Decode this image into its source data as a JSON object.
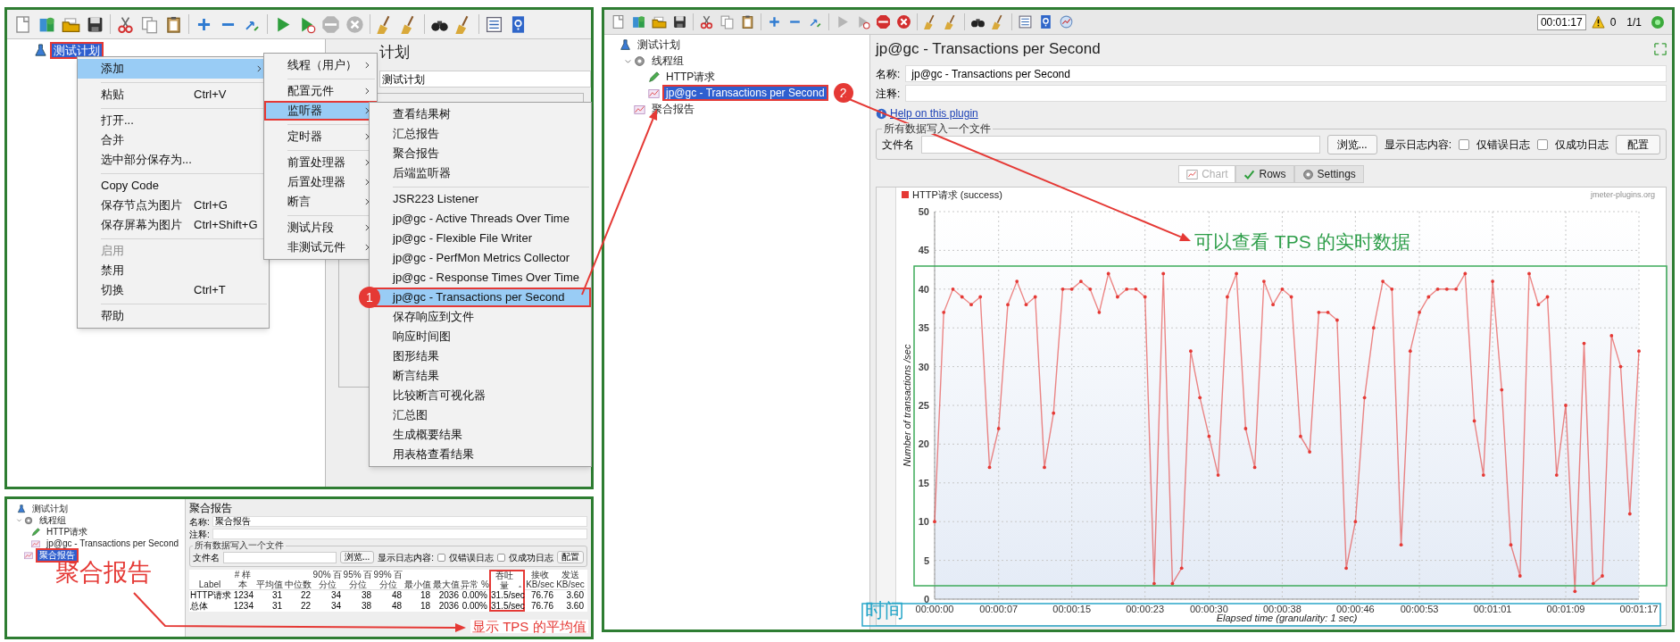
{
  "menu_screenshot": {
    "running": false,
    "tree": [
      {
        "label": "测试计划",
        "kind": "plan",
        "selected": true,
        "annotated": true
      }
    ],
    "editor": {
      "title": "计划",
      "name_value": "测试计划"
    },
    "context_menu": [
      {
        "label": "添加",
        "selected": true,
        "disabled": false,
        "submenu": true,
        "separator_before": false,
        "annotated": false
      },
      {
        "label": "粘贴",
        "shortcut": "Ctrl+V",
        "selected": false,
        "disabled": false,
        "submenu": false,
        "separator_before": true,
        "annotated": false
      },
      {
        "label": "打开...",
        "selected": false,
        "disabled": false,
        "submenu": false,
        "separator_before": true,
        "annotated": false
      },
      {
        "label": "合并",
        "selected": false,
        "disabled": false,
        "submenu": false,
        "separator_before": false,
        "annotated": false
      },
      {
        "label": "选中部分保存为...",
        "selected": false,
        "disabled": false,
        "submenu": false,
        "separator_before": false,
        "annotated": false
      },
      {
        "label": "Copy Code",
        "selected": false,
        "disabled": false,
        "submenu": false,
        "separator_before": true,
        "annotated": false
      },
      {
        "label": "保存节点为图片",
        "shortcut": "Ctrl+G",
        "selected": false,
        "disabled": false,
        "submenu": false,
        "separator_before": false,
        "annotated": false
      },
      {
        "label": "保存屏幕为图片",
        "shortcut": "Ctrl+Shift+G",
        "selected": false,
        "disabled": false,
        "submenu": false,
        "separator_before": false,
        "annotated": false
      },
      {
        "label": "启用",
        "selected": false,
        "disabled": true,
        "submenu": false,
        "separator_before": true,
        "annotated": false
      },
      {
        "label": "禁用",
        "selected": false,
        "disabled": false,
        "submenu": false,
        "separator_before": false,
        "annotated": false
      },
      {
        "label": "切换",
        "shortcut": "Ctrl+T",
        "selected": false,
        "disabled": false,
        "submenu": false,
        "separator_before": false,
        "annotated": false
      },
      {
        "label": "帮助",
        "selected": false,
        "disabled": false,
        "submenu": false,
        "separator_before": true,
        "annotated": false
      }
    ],
    "add_menu": [
      {
        "label": "线程（用户）",
        "selected": false,
        "disabled": false,
        "submenu": true,
        "separator_before": false,
        "annotated": false
      },
      {
        "label": "配置元件",
        "selected": false,
        "disabled": false,
        "submenu": true,
        "separator_before": true,
        "annotated": false
      },
      {
        "label": "监听器",
        "selected": true,
        "disabled": false,
        "submenu": true,
        "separator_before": false,
        "annotated": true
      },
      {
        "label": "定时器",
        "selected": false,
        "disabled": false,
        "submenu": true,
        "separator_before": true,
        "annotated": false
      },
      {
        "label": "前置处理器",
        "selected": false,
        "disabled": false,
        "submenu": true,
        "separator_before": true,
        "annotated": false
      },
      {
        "label": "后置处理器",
        "selected": false,
        "disabled": false,
        "submenu": true,
        "separator_before": false,
        "annotated": false
      },
      {
        "label": "断言",
        "selected": false,
        "disabled": false,
        "submenu": true,
        "separator_before": false,
        "annotated": false
      },
      {
        "label": "测试片段",
        "selected": false,
        "disabled": false,
        "submenu": true,
        "separator_before": true,
        "annotated": false
      },
      {
        "label": "非测试元件",
        "selected": false,
        "disabled": false,
        "submenu": true,
        "separator_before": false,
        "annotated": false
      }
    ],
    "listener_menu": [
      {
        "label": "查看结果树",
        "selected": false,
        "disabled": false,
        "submenu": false,
        "separator_before": false,
        "annotated": false
      },
      {
        "label": "汇总报告",
        "selected": false,
        "disabled": false,
        "submenu": false,
        "separator_before": false,
        "annotated": false
      },
      {
        "label": "聚合报告",
        "selected": false,
        "disabled": false,
        "submenu": false,
        "separator_before": false,
        "annotated": false
      },
      {
        "label": "后端监听器",
        "selected": false,
        "disabled": false,
        "submenu": false,
        "separator_before": false,
        "annotated": false
      },
      {
        "label": "JSR223 Listener",
        "selected": false,
        "disabled": false,
        "submenu": false,
        "separator_before": true,
        "annotated": false
      },
      {
        "label": "jp@gc - Active Threads Over Time",
        "selected": false,
        "disabled": false,
        "submenu": false,
        "separator_before": false,
        "annotated": false
      },
      {
        "label": "jp@gc - Flexible File Writer",
        "selected": false,
        "disabled": false,
        "submenu": false,
        "separator_before": false,
        "annotated": false
      },
      {
        "label": "jp@gc - PerfMon Metrics Collector",
        "selected": false,
        "disabled": false,
        "submenu": false,
        "separator_before": false,
        "annotated": false
      },
      {
        "label": "jp@gc - Response Times Over Time",
        "selected": false,
        "disabled": false,
        "submenu": false,
        "separator_before": false,
        "annotated": false
      },
      {
        "label": "jp@gc - Transactions per Second",
        "selected": true,
        "disabled": false,
        "submenu": false,
        "separator_before": false,
        "annotated": true,
        "badge": "1"
      },
      {
        "label": "保存响应到文件",
        "selected": false,
        "disabled": false,
        "submenu": false,
        "separator_before": false,
        "annotated": false
      },
      {
        "label": "响应时间图",
        "selected": false,
        "disabled": false,
        "submenu": false,
        "separator_before": false,
        "annotated": false
      },
      {
        "label": "图形结果",
        "selected": false,
        "disabled": false,
        "submenu": false,
        "separator_before": false,
        "annotated": false
      },
      {
        "label": "断言结果",
        "selected": false,
        "disabled": false,
        "submenu": false,
        "separator_before": false,
        "annotated": false
      },
      {
        "label": "比较断言可视化器",
        "selected": false,
        "disabled": false,
        "submenu": false,
        "separator_before": false,
        "annotated": false
      },
      {
        "label": "汇总图",
        "selected": false,
        "disabled": false,
        "submenu": false,
        "separator_before": false,
        "annotated": false
      },
      {
        "label": "生成概要结果",
        "selected": false,
        "disabled": false,
        "submenu": false,
        "separator_before": false,
        "annotated": false
      },
      {
        "label": "用表格查看结果",
        "selected": false,
        "disabled": false,
        "submenu": false,
        "separator_before": false,
        "annotated": false
      }
    ]
  },
  "summary_screenshot": {
    "tree": [
      {
        "label": "测试计划",
        "kind": "plan",
        "selected": false,
        "annotated": false,
        "children": [
          {
            "label": "线程组",
            "kind": "group",
            "selected": false,
            "annotated": false,
            "expanded": true,
            "children": [
              {
                "label": "HTTP请求",
                "kind": "sampler",
                "selected": false,
                "annotated": false
              },
              {
                "label": "jp@gc - Transactions per Second",
                "kind": "listener",
                "selected": false,
                "annotated": false
              }
            ]
          },
          {
            "label": "聚合报告",
            "kind": "listener",
            "selected": true,
            "annotated": true
          }
        ]
      }
    ],
    "editor": {
      "title": "聚合报告",
      "name_label": "名称:",
      "name_value": "聚合报告",
      "comment_label": "注释:",
      "file_group": {
        "legend": "所有数据写入一个文件",
        "file_label": "文件名",
        "browse_button": "浏览...",
        "log_label": "显示日志内容:",
        "checkboxes": [
          {
            "label": "仅错误日志",
            "checked": false
          },
          {
            "label": "仅成功日志",
            "checked": false
          }
        ],
        "config_button": "配置"
      }
    },
    "table": {
      "columns": [
        {
          "label": "Label",
          "sorted": false,
          "annotated": false
        },
        {
          "label": "# 样本",
          "sorted": false,
          "annotated": false
        },
        {
          "label": "平均值",
          "sorted": false,
          "annotated": false
        },
        {
          "label": "中位数",
          "sorted": false,
          "annotated": false
        },
        {
          "label": "90% 百分位",
          "sorted": false,
          "annotated": false
        },
        {
          "label": "95% 百分位",
          "sorted": false,
          "annotated": false
        },
        {
          "label": "99% 百分位",
          "sorted": false,
          "annotated": false
        },
        {
          "label": "最小值",
          "sorted": false,
          "annotated": false
        },
        {
          "label": "最大值",
          "sorted": false,
          "annotated": false
        },
        {
          "label": "异常 %",
          "sorted": false,
          "annotated": false
        },
        {
          "label": "吞吐量",
          "sorted": true,
          "annotated": true
        },
        {
          "label": "接收 KB/sec",
          "sorted": false,
          "annotated": false
        },
        {
          "label": "发送 KB/sec",
          "sorted": false,
          "annotated": false
        }
      ],
      "rows": [
        [
          "HTTP请求",
          "1234",
          "31",
          "22",
          "34",
          "38",
          "48",
          "18",
          "2036",
          "0.00%",
          "31.5/sec",
          "76.76",
          "3.60"
        ],
        [
          "总体",
          "1234",
          "31",
          "22",
          "34",
          "38",
          "48",
          "18",
          "2036",
          "0.00%",
          "31.5/sec",
          "76.76",
          "3.60"
        ]
      ]
    }
  },
  "tps_screenshot": {
    "running": true,
    "elapsed": "00:01:17",
    "error_count": "0",
    "threads": "1/1",
    "tree": [
      {
        "label": "测试计划",
        "kind": "plan",
        "selected": false,
        "annotated": false,
        "children": [
          {
            "label": "线程组",
            "kind": "group",
            "selected": false,
            "annotated": false,
            "expanded": true,
            "children": [
              {
                "label": "HTTP请求",
                "kind": "sampler",
                "selected": false,
                "annotated": false
              },
              {
                "label": "jp@gc - Transactions per Second",
                "kind": "listener",
                "selected": true,
                "annotated": true,
                "badge": "2"
              }
            ]
          },
          {
            "label": "聚合报告",
            "kind": "listener",
            "selected": false,
            "annotated": false
          }
        ]
      }
    ],
    "editor": {
      "title": "jp@gc - Transactions per Second",
      "name_label": "名称:",
      "name_value": "jp@gc - Transactions per Second",
      "comment_label": "注释:",
      "help_link": "Help on this plugin",
      "file_group": {
        "legend": "所有数据写入一个文件",
        "file_label": "文件名",
        "browse_button": "浏览...",
        "log_label": "显示日志内容:",
        "checkboxes": [
          {
            "label": "仅错误日志",
            "checked": false
          },
          {
            "label": "仅成功日志",
            "checked": false
          }
        ],
        "config_button": "配置"
      },
      "tabs": [
        {
          "label": "Chart",
          "kind": "chart",
          "selected": true
        },
        {
          "label": "Rows",
          "kind": "rows",
          "selected": false
        },
        {
          "label": "Settings",
          "kind": "settings",
          "selected": false
        }
      ],
      "chart": {
        "watermark": "jmeter-plugins.org",
        "chart_data": {
          "type": "line",
          "xlabel": "Elapsed time (granularity: 1 sec)",
          "ylabel": "Number of transactions /sec",
          "x": [
            0,
            1,
            2,
            3,
            4,
            5,
            6,
            7,
            8,
            9,
            10,
            11,
            12,
            13,
            14,
            15,
            16,
            17,
            18,
            19,
            20,
            21,
            22,
            23,
            24,
            25,
            26,
            27,
            28,
            29,
            30,
            31,
            32,
            33,
            34,
            35,
            36,
            37,
            38,
            39,
            40,
            41,
            42,
            43,
            44,
            45,
            46,
            47,
            48,
            49,
            50,
            51,
            52,
            53,
            54,
            55,
            56,
            57,
            58,
            59,
            60,
            61,
            62,
            63,
            64,
            65,
            66,
            67,
            68,
            69,
            70,
            71,
            72,
            73,
            74,
            75,
            76,
            77
          ],
          "series": [
            {
              "name": "HTTP请求 (success)",
              "color": "#e53935",
              "values": [
                10,
                37,
                40,
                39,
                38,
                39,
                17,
                22,
                38,
                41,
                38,
                39,
                17,
                24,
                40,
                40,
                41,
                40,
                37,
                42,
                39,
                40,
                40,
                39,
                2,
                42,
                2,
                4,
                32,
                26,
                21,
                16,
                39,
                42,
                22,
                17,
                41,
                38,
                40,
                39,
                21,
                19,
                37,
                37,
                36,
                4,
                10,
                26,
                35,
                41,
                40,
                7,
                32,
                37,
                39,
                40,
                40,
                40,
                42,
                23,
                16,
                41,
                27,
                7,
                3,
                42,
                38,
                39,
                16,
                25,
                1,
                33,
                2,
                3,
                34,
                30,
                11,
                32
              ]
            }
          ],
          "xlim": [
            0,
            77
          ],
          "ylim": [
            0,
            50
          ],
          "grid": true,
          "xticks": [
            {
              "value": 0,
              "label": "00:00:00"
            },
            {
              "value": 7,
              "label": "00:00:07"
            },
            {
              "value": 15,
              "label": "00:00:15"
            },
            {
              "value": 23,
              "label": "00:00:23"
            },
            {
              "value": 30,
              "label": "00:00:30"
            },
            {
              "value": 38,
              "label": "00:00:38"
            },
            {
              "value": 46,
              "label": "00:00:46"
            },
            {
              "value": 53,
              "label": "00:00:53"
            },
            {
              "value": 61,
              "label": "00:01:01"
            },
            {
              "value": 69,
              "label": "00:01:09"
            },
            {
              "value": 77,
              "label": "00:01:17"
            }
          ],
          "yticks": [
            0,
            5,
            10,
            15,
            20,
            25,
            30,
            35,
            40,
            45,
            50
          ]
        }
      }
    }
  },
  "annotations": [
    {
      "kind": "chart-note",
      "text": "可以查看 TPS 的实时数据",
      "color": "#2e9e4a"
    },
    {
      "kind": "tree-note",
      "text": "聚合报告",
      "color": "#e53935"
    },
    {
      "kind": "table-note",
      "text": "显示 TPS 的平均值",
      "color": "#e53935"
    },
    {
      "kind": "axis-note",
      "text": "时间",
      "color": "#2aa7c9"
    }
  ]
}
